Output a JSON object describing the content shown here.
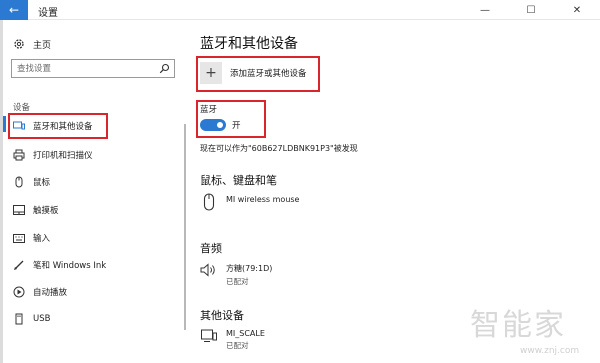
{
  "window": {
    "back_glyph": "←",
    "title": "设置",
    "min_glyph": "—",
    "max_glyph": "☐",
    "close_glyph": "✕"
  },
  "sidebar": {
    "home_label": "主页",
    "search_placeholder": "查找设置",
    "section_label": "设备",
    "items": [
      {
        "label": "蓝牙和其他设备",
        "icon": "devices-icon"
      },
      {
        "label": "打印机和扫描仪",
        "icon": "printer-icon"
      },
      {
        "label": "鼠标",
        "icon": "mouse-icon"
      },
      {
        "label": "触摸板",
        "icon": "touchpad-icon"
      },
      {
        "label": "输入",
        "icon": "keyboard-icon"
      },
      {
        "label": "笔和 Windows Ink",
        "icon": "pen-icon"
      },
      {
        "label": "自动播放",
        "icon": "autoplay-icon"
      },
      {
        "label": "USB",
        "icon": "usb-icon"
      }
    ]
  },
  "main": {
    "title": "蓝牙和其他设备",
    "add_plus": "+",
    "add_label": "添加蓝牙或其他设备",
    "bluetooth_label": "蓝牙",
    "bluetooth_state": "开",
    "bluetooth_on": true,
    "discoverable_text": "现在可以作为\"60B627LDBNK91P3\"被发现",
    "groups": [
      {
        "title": "鼠标、键盘和笔",
        "devices": [
          {
            "name": "MI wireless mouse",
            "status": "",
            "icon": "mouse-icon"
          }
        ]
      },
      {
        "title": "音频",
        "devices": [
          {
            "name": "方糖(79:1D)",
            "status": "已配对",
            "icon": "speaker-icon"
          }
        ]
      },
      {
        "title": "其他设备",
        "devices": [
          {
            "name": "MI_SCALE",
            "status": "已配对",
            "icon": "device-icon"
          }
        ]
      }
    ]
  },
  "watermark": {
    "main": "智能家",
    "url": "www.znj.com"
  },
  "colors": {
    "accent": "#2b79d0",
    "highlight": "#d9262d"
  }
}
